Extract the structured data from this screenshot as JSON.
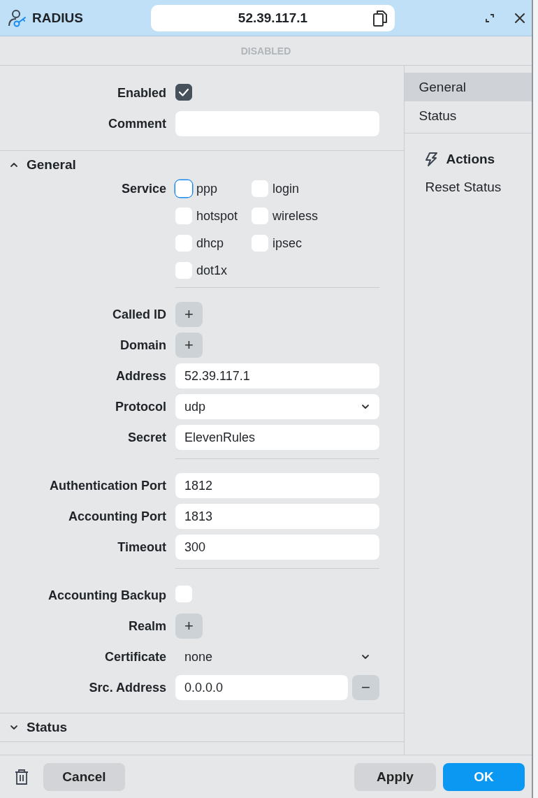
{
  "window": {
    "title": "RADIUS",
    "address": "52.39.117.1"
  },
  "status_strip": "DISABLED",
  "top_fields": [
    {
      "kind": "checkbox",
      "label": "Enabled",
      "checked": true
    },
    {
      "kind": "text",
      "label": "Comment"
    }
  ],
  "sections": [
    {
      "title": "General",
      "expanded": true,
      "rows": [
        {
          "kind": "checkgroup",
          "label": "Service",
          "options": [
            {
              "label": "ppp",
              "checked": false,
              "focused": true
            },
            {
              "label": "login",
              "checked": false,
              "focused": false
            },
            {
              "label": "hotspot",
              "checked": false,
              "focused": false
            },
            {
              "label": "wireless",
              "checked": false,
              "focused": false
            },
            {
              "label": "dhcp",
              "checked": false,
              "focused": false
            },
            {
              "label": "ipsec",
              "checked": false,
              "focused": false
            },
            {
              "label": "dot1x",
              "checked": false,
              "focused": false
            }
          ]
        },
        {
          "kind": "divider"
        },
        {
          "kind": "add",
          "label": "Called ID",
          "button": "+"
        },
        {
          "kind": "add",
          "label": "Domain",
          "button": "+"
        },
        {
          "kind": "text",
          "label": "Address",
          "value": "52.39.117.1"
        },
        {
          "kind": "select",
          "label": "Protocol",
          "value": "udp",
          "boxed": true
        },
        {
          "kind": "text",
          "label": "Secret",
          "value": "ElevenRules"
        },
        {
          "kind": "divider"
        },
        {
          "kind": "text",
          "label": "Authentication Port",
          "value": "1812"
        },
        {
          "kind": "text",
          "label": "Accounting Port",
          "value": "1813"
        },
        {
          "kind": "text",
          "label": "Timeout",
          "value": "300"
        },
        {
          "kind": "divider"
        },
        {
          "kind": "checkbox",
          "label": "Accounting Backup",
          "checked": false
        },
        {
          "kind": "add",
          "label": "Realm",
          "button": "+"
        },
        {
          "kind": "select",
          "label": "Certificate",
          "value": "none",
          "boxed": false
        },
        {
          "kind": "text",
          "label": "Src. Address",
          "value": "0.0.0.0",
          "remove_button": "−"
        }
      ]
    },
    {
      "title": "Status",
      "expanded": false
    }
  ],
  "sidebar": {
    "nav": [
      {
        "label": "General",
        "selected": true
      },
      {
        "label": "Status",
        "selected": false
      }
    ],
    "actions": {
      "title": "Actions",
      "items": [
        "Reset Status"
      ]
    }
  },
  "footer": {
    "cancel": "Cancel",
    "apply": "Apply",
    "ok": "OK"
  }
}
